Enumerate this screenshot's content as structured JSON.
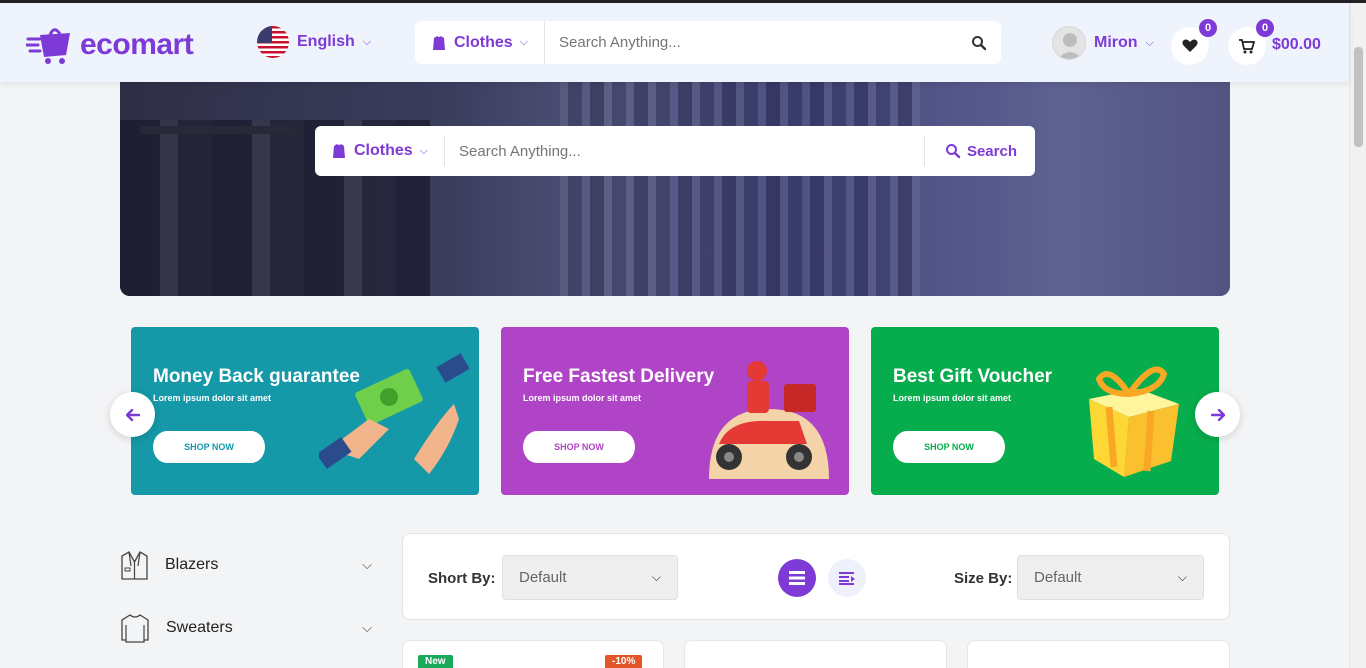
{
  "header": {
    "logo_text": "ecomart",
    "language": "English",
    "category": "Clothes",
    "search_placeholder": "Search Anything...",
    "user_name": "Miron",
    "wishlist_count": "0",
    "cart_count": "0",
    "cart_total": "$00.00"
  },
  "hero": {
    "category": "Clothes",
    "search_placeholder": "Search Anything...",
    "search_button": "Search"
  },
  "banners": [
    {
      "title": "Money Back guarantee",
      "subtitle": "Lorem ipsum dolor sit amet",
      "button": "SHOP NOW",
      "color": "#1598a8"
    },
    {
      "title": "Free Fastest Delivery",
      "subtitle": "Lorem ipsum dolor sit amet",
      "button": "SHOP NOW",
      "color": "#b044c6"
    },
    {
      "title": "Best Gift Voucher",
      "subtitle": "Lorem ipsum dolor sit amet",
      "button": "SHOP NOW",
      "color": "#07ad4c"
    }
  ],
  "sidebar": {
    "items": [
      {
        "label": "Blazers",
        "icon": "blazer-icon"
      },
      {
        "label": "Sweaters",
        "icon": "sweater-icon"
      }
    ]
  },
  "filter": {
    "sort_label": "Short By:",
    "sort_value": "Default",
    "size_label": "Size By:",
    "size_value": "Default"
  },
  "products": {
    "tag_new": "New",
    "tag_discount": "-10%"
  },
  "colors": {
    "brand": "#7e3ad6",
    "tag_new": "#1aa85a",
    "tag_discount": "#e2572a"
  }
}
